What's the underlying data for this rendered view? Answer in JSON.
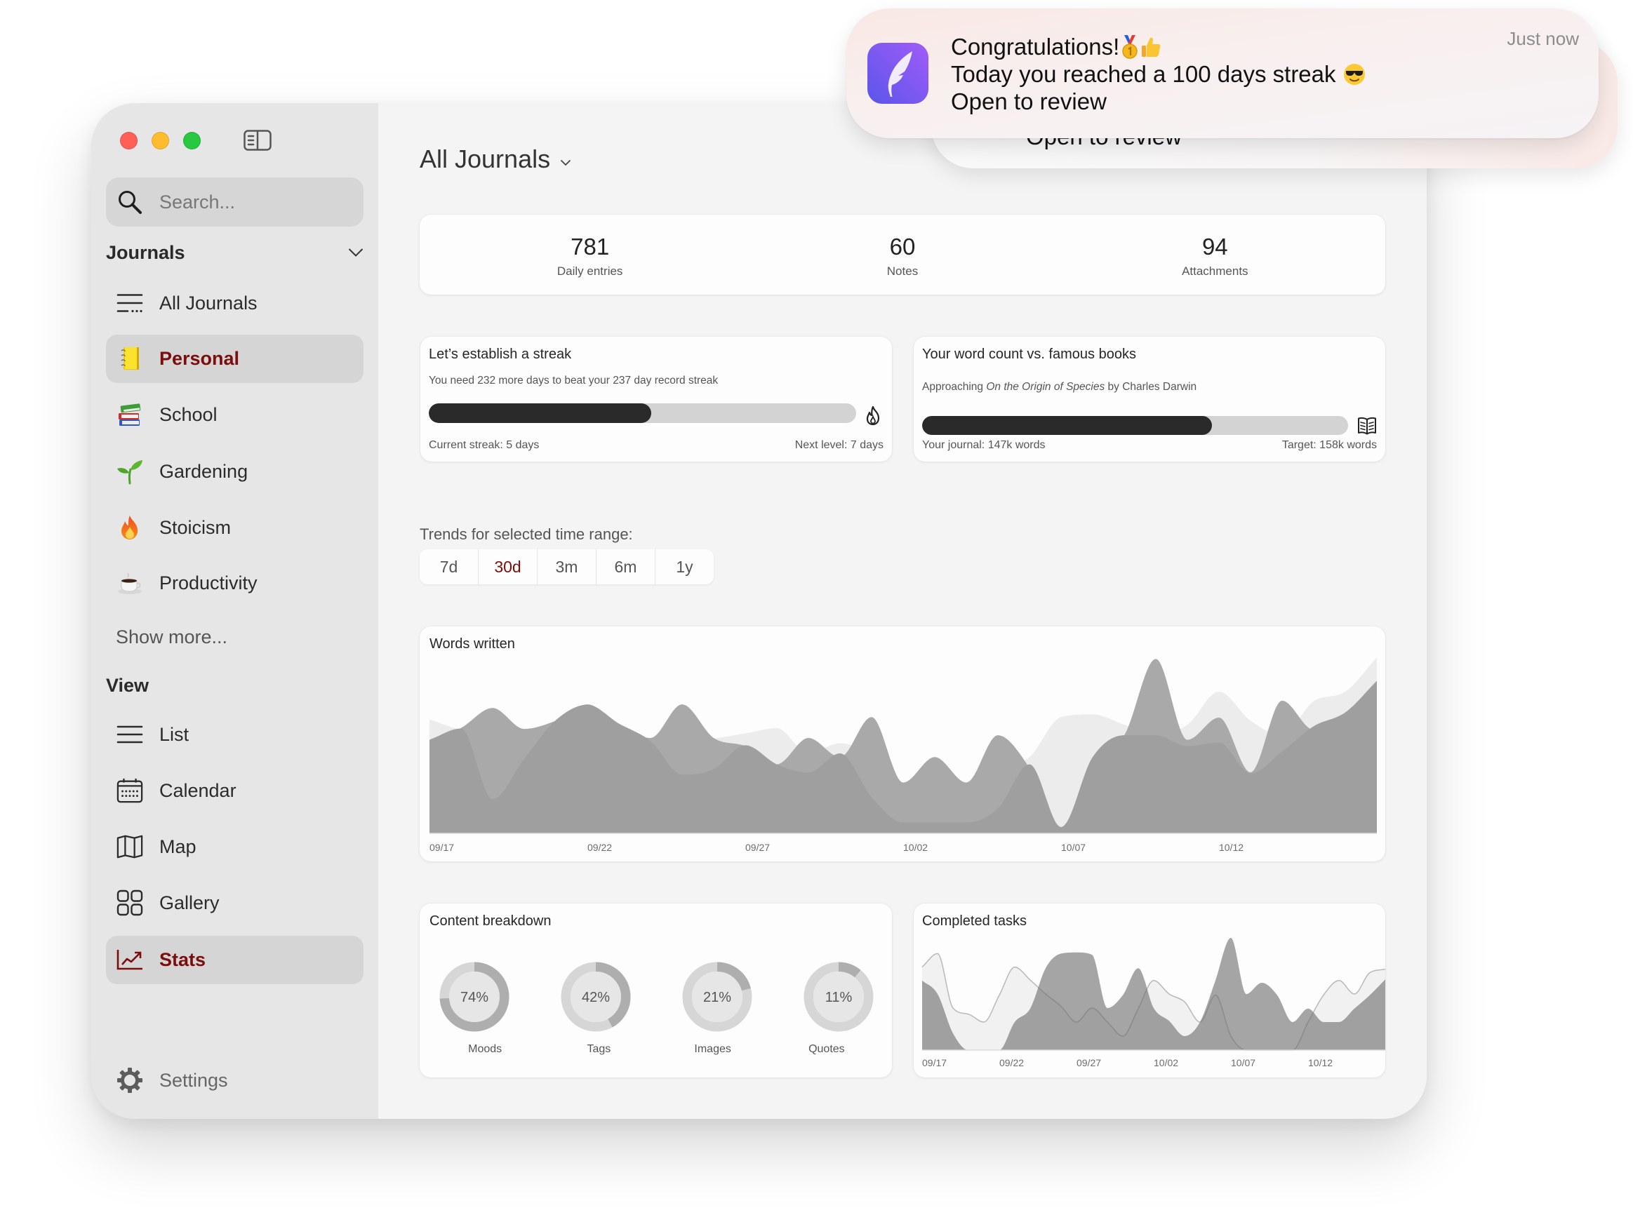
{
  "colors": {
    "accent": "#7b0d0d",
    "sidebar_bg": "#e6e6e6",
    "main_bg": "#f4f4f4",
    "selected_bg": "#d5d5d5",
    "card_bg": "#fdfdfd",
    "progress_fill": "#2a2a2a",
    "progress_track": "#d3d3d3",
    "traffic_close": "#ff5f57",
    "traffic_minimize": "#febc2e",
    "traffic_zoom": "#28c840",
    "app_icon_gradient": [
      "#5a55ea",
      "#a15cf8"
    ]
  },
  "window": {
    "controls": [
      {
        "name": "close",
        "icon": "close-traffic-light"
      },
      {
        "name": "minimize",
        "icon": "minimize-traffic-light"
      },
      {
        "name": "zoom",
        "icon": "zoom-traffic-light"
      }
    ],
    "sidebar_toggle_icon": "sidebar-toggle-icon"
  },
  "sidebar": {
    "search": {
      "placeholder": "Search...",
      "value": "",
      "icon": "search-icon"
    },
    "journals_header": "Journals",
    "journals_collapse_icon": "chevron-down-icon",
    "journals": [
      {
        "label": "All Journals",
        "icon": "all-journals-icon",
        "selected": false
      },
      {
        "label": "Personal",
        "icon": "notebook-icon",
        "emoji": "📒",
        "selected": true
      },
      {
        "label": "School",
        "icon": "books-icon",
        "emoji": "📚",
        "selected": false
      },
      {
        "label": "Gardening",
        "icon": "seedling-icon",
        "emoji": "🌱",
        "selected": false
      },
      {
        "label": "Stoicism",
        "icon": "fire-icon",
        "emoji": "🔥",
        "selected": false
      },
      {
        "label": "Productivity",
        "icon": "coffee-icon",
        "emoji": "☕",
        "selected": false
      }
    ],
    "show_more": "Show more...",
    "view_header": "View",
    "views": [
      {
        "label": "List",
        "icon": "list-icon",
        "selected": false
      },
      {
        "label": "Calendar",
        "icon": "calendar-icon",
        "selected": false
      },
      {
        "label": "Map",
        "icon": "map-icon",
        "selected": false
      },
      {
        "label": "Gallery",
        "icon": "gallery-icon",
        "selected": false
      },
      {
        "label": "Stats",
        "icon": "stats-icon",
        "selected": true
      }
    ],
    "settings": {
      "label": "Settings",
      "icon": "gear-icon"
    }
  },
  "main": {
    "title": "All Journals",
    "title_icon": "chevron-down-icon",
    "stats": [
      {
        "value": "781",
        "label": "Daily entries"
      },
      {
        "value": "60",
        "label": "Notes"
      },
      {
        "value": "94",
        "label": "Attachments"
      }
    ],
    "streak": {
      "title": "Let’s establish a streak",
      "subtitle": "You need 232 more days to beat your 237 day record streak",
      "progress": 0.52,
      "icon": "flame-icon",
      "current": "Current streak: 5 days",
      "next": "Next level: 7 days"
    },
    "word_count": {
      "title": "Your word count vs. famous books",
      "subtitle_prefix": "Approaching ",
      "book_title": "On the Origin of Species",
      "subtitle_suffix": " by Charles Darwin",
      "progress": 0.68,
      "icon": "open-book-icon",
      "journal": "Your journal: 147k words",
      "target": "Target: 158k words"
    },
    "trends_label": "Trends for selected time range:",
    "ranges": [
      {
        "label": "7d",
        "selected": false
      },
      {
        "label": "30d",
        "selected": true
      },
      {
        "label": "3m",
        "selected": false
      },
      {
        "label": "6m",
        "selected": false
      },
      {
        "label": "1y",
        "selected": false
      }
    ],
    "words_title": "Words written",
    "content_title": "Content breakdown",
    "tasks_title": "Completed tasks"
  },
  "notification": {
    "app_icon": "feather-app-icon",
    "title": "Congratulations!",
    "title_emoji": [
      {
        "char": "🥇",
        "icon": "medal-icon"
      },
      {
        "char": "👍",
        "icon": "thumbs-up-icon"
      }
    ],
    "body": "Today you reached a 100 days streak",
    "body_emoji": {
      "char": "😎",
      "icon": "sunglasses-face-icon"
    },
    "action": "Open to review",
    "time": "Just now"
  },
  "notification_stacked": {
    "action": "Open to review"
  },
  "chart_data": [
    {
      "type": "area",
      "title": "Words written",
      "xlabel": "",
      "ylabel": "",
      "ylim": [
        0,
        100
      ],
      "grid": false,
      "legend": "none",
      "categories": [
        "09/17",
        "09/18",
        "09/19",
        "09/20",
        "09/21",
        "09/22",
        "09/23",
        "09/24",
        "09/25",
        "09/26",
        "09/27",
        "09/28",
        "09/29",
        "09/30",
        "10/01",
        "10/02",
        "10/03",
        "10/04",
        "10/05",
        "10/06",
        "10/07",
        "10/08",
        "10/09",
        "10/10",
        "10/11",
        "10/12",
        "10/13",
        "10/14",
        "10/15",
        "10/16",
        "10/17"
      ],
      "x_ticks": [
        "09/17",
        "09/22",
        "09/27",
        "10/02",
        "10/07",
        "10/12"
      ],
      "series": [
        {
          "fill": "#ececec",
          "values": [
            62.7,
            57,
            55,
            56,
            61,
            65,
            60.5,
            51,
            48,
            52,
            55,
            57.9,
            44,
            49.6,
            42,
            20,
            15,
            28,
            34,
            42,
            64,
            65.5,
            59.8,
            54,
            59.8,
            78,
            62,
            54,
            72.7,
            78,
            96.8
          ]
        },
        {
          "fill": "#a9a9a9",
          "values": [
            50,
            58,
            69,
            57.5,
            62,
            71,
            60,
            52.5,
            71,
            52.5,
            48,
            38,
            52.5,
            42,
            64,
            28,
            42,
            28,
            54,
            36,
            3,
            40,
            54,
            96,
            51.5,
            63.7,
            33.6,
            73,
            57,
            63,
            82
          ]
        },
        {
          "fill": "#9f9f9f",
          "values": [
            51.5,
            57.7,
            18.8,
            41,
            62.3,
            70.8,
            60.4,
            50.8,
            32.3,
            35.4,
            48.5,
            38,
            33.5,
            44,
            20,
            6,
            6,
            6,
            13.7,
            38,
            3.5,
            42,
            54,
            54,
            48,
            50,
            33,
            45,
            59,
            66.6,
            84
          ]
        }
      ]
    },
    {
      "type": "pie",
      "variant": "donut",
      "title": "Content breakdown",
      "categories": [
        "Moods",
        "Tags",
        "Images",
        "Quotes"
      ],
      "values": [
        74,
        42,
        21,
        11
      ],
      "unit": "%",
      "colors": {
        "track": "#d6d6d6",
        "value": "#aeaeae",
        "center": "#e6e6e6"
      }
    },
    {
      "type": "area",
      "title": "Completed tasks",
      "xlabel": "",
      "ylabel": "",
      "ylim": [
        0,
        10
      ],
      "grid": false,
      "legend": "none",
      "categories": [
        "09/17",
        "09/18",
        "09/19",
        "09/20",
        "09/21",
        "09/22",
        "09/23",
        "09/24",
        "09/25",
        "09/26",
        "09/27",
        "09/28",
        "09/29",
        "09/30",
        "10/01",
        "10/02",
        "10/03",
        "10/04",
        "10/05",
        "10/06",
        "10/07",
        "10/08",
        "10/09",
        "10/10",
        "10/11",
        "10/12",
        "10/13",
        "10/14",
        "10/15",
        "10/16",
        "10/17"
      ],
      "x_ticks": [
        "09/17",
        "09/22",
        "09/27",
        "10/02",
        "10/07",
        "10/12"
      ],
      "series": [
        {
          "fill": "#f1f1f1",
          "stroke": "#b8b8b8",
          "values": [
            7.4,
            8.6,
            3.75,
            3.2,
            2.5,
            4.9,
            7.4,
            6.25,
            5.0,
            3.9,
            2.5,
            3.75,
            2.5,
            1.25,
            3.7,
            6.2,
            5.0,
            4.3,
            2.5,
            4.9,
            1.25,
            0,
            0,
            0,
            0,
            2.5,
            4.9,
            6.2,
            5.0,
            6.9,
            7.2
          ]
        },
        {
          "fill": "#6b6b6b",
          "opacity": 0.6,
          "values": [
            6.2,
            5.0,
            1.5,
            0,
            0,
            0,
            2.5,
            3.7,
            7.3,
            8.6,
            8.7,
            8.5,
            3.75,
            4.9,
            7.3,
            3.75,
            2.6,
            1.25,
            2.5,
            6.2,
            10,
            5.0,
            6.0,
            4.9,
            2.5,
            3.7,
            2.5,
            2.5,
            3.7,
            4.9,
            6.3
          ]
        }
      ]
    }
  ]
}
